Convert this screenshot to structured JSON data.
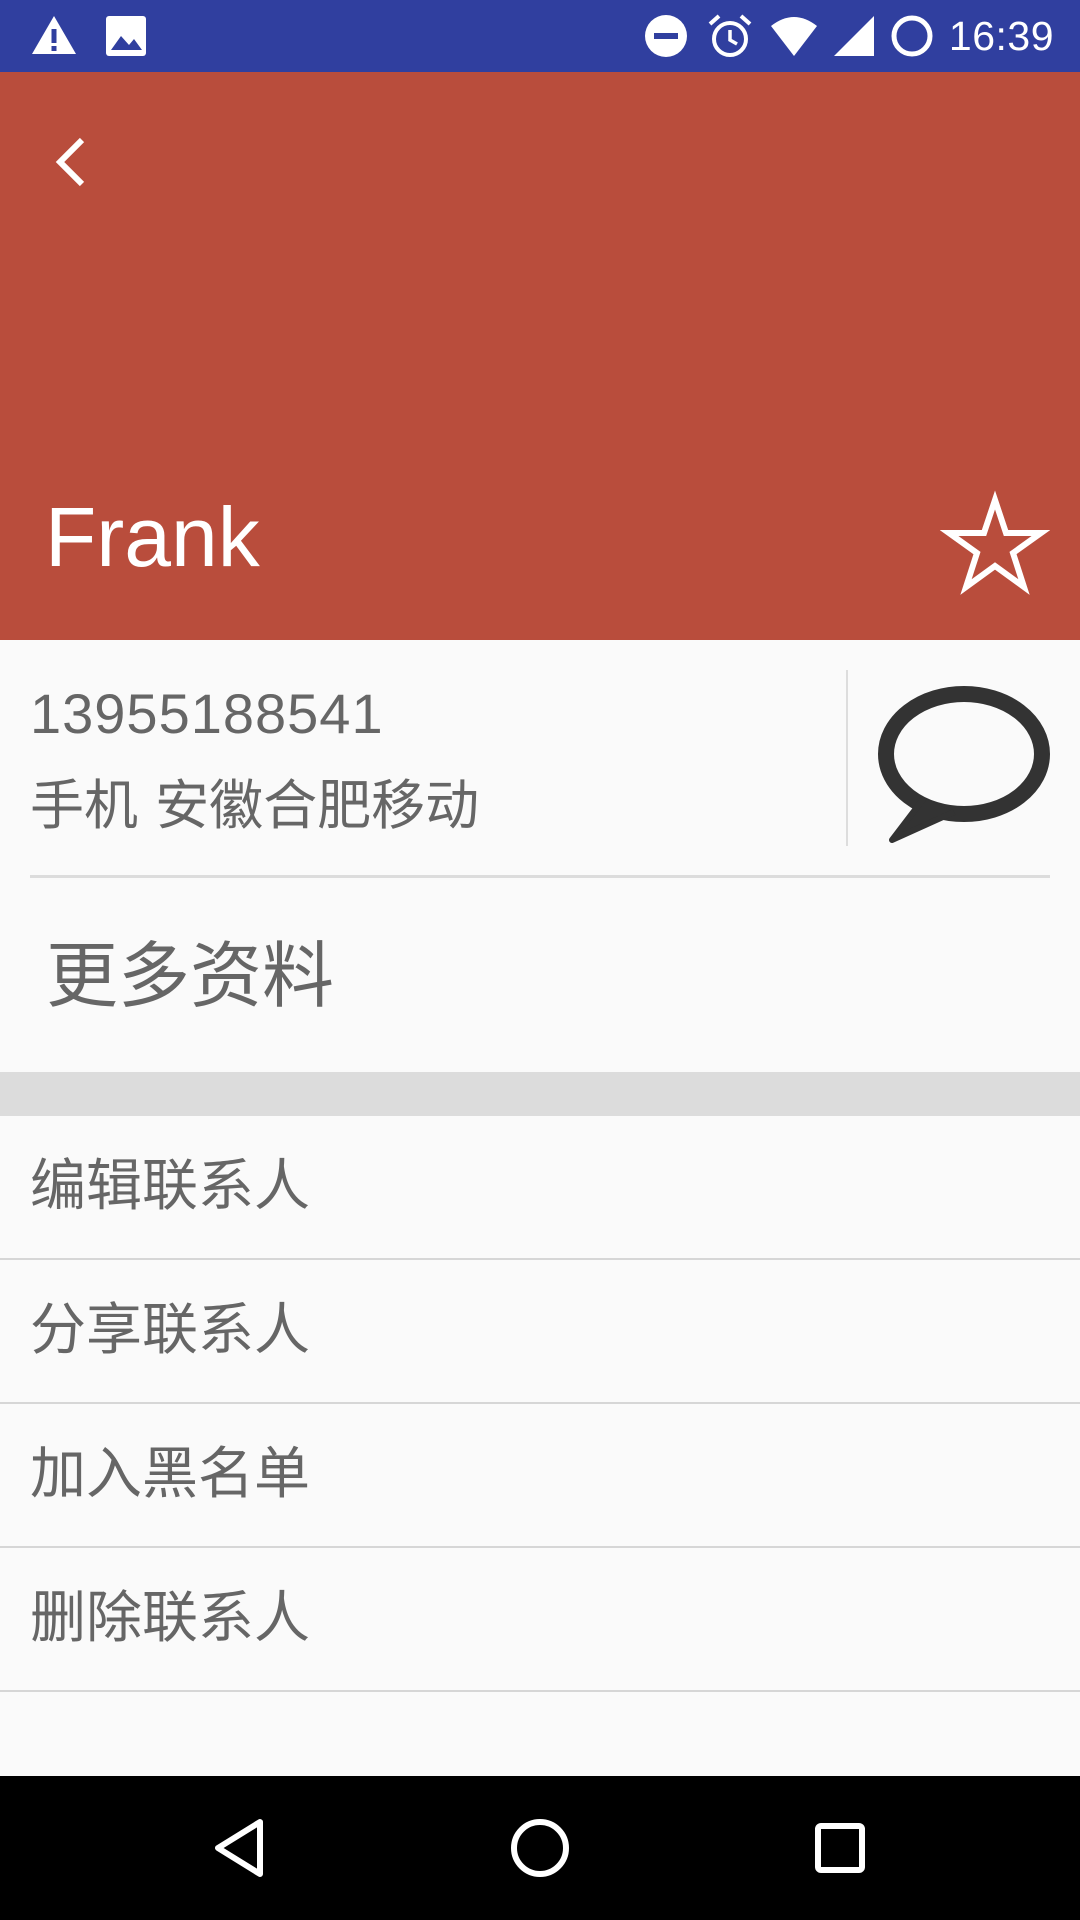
{
  "status_bar": {
    "time": "16:39",
    "icons": [
      "warning-icon",
      "image-icon",
      "do-not-disturb-icon",
      "alarm-icon",
      "wifi-icon",
      "signal-icon",
      "battery-icon"
    ],
    "background": "#303f9f"
  },
  "header": {
    "contact_name": "Frank",
    "background": "#b94d3c",
    "back_icon": "back-chevron-icon",
    "star_icon": "star-outline-icon"
  },
  "phone": {
    "number": "13955188541",
    "meta": "手机 安徽合肥移动",
    "message_icon": "speech-bubble-icon"
  },
  "more_info": {
    "label": "更多资料"
  },
  "actions": [
    {
      "label": "编辑联系人"
    },
    {
      "label": "分享联系人"
    },
    {
      "label": "加入黑名单"
    },
    {
      "label": "删除联系人"
    }
  ],
  "nav_bar": {
    "icons": [
      "nav-back-icon",
      "nav-home-icon",
      "nav-recents-icon"
    ]
  }
}
